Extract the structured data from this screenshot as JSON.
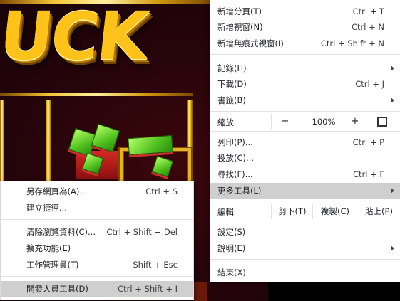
{
  "background": {
    "headline_text": "UCK"
  },
  "menu": {
    "new_tab": {
      "label": "新增分頁(T)",
      "shortcut": "Ctrl + T"
    },
    "new_window": {
      "label": "新增視窗(N)",
      "shortcut": "Ctrl + N"
    },
    "new_incognito": {
      "label": "新增無痕式視窗(I)",
      "shortcut": "Ctrl + Shift + N"
    },
    "history": {
      "label": "記錄(H)"
    },
    "downloads": {
      "label": "下載(D)",
      "shortcut": "Ctrl + J"
    },
    "bookmarks": {
      "label": "書籤(B)"
    },
    "zoom": {
      "label": "縮放",
      "minus": "−",
      "value": "100%",
      "plus": "+"
    },
    "print": {
      "label": "列印(P)...",
      "shortcut": "Ctrl + P"
    },
    "cast": {
      "label": "投放(C)..."
    },
    "find": {
      "label": "尋找(F)...",
      "shortcut": "Ctrl + F"
    },
    "more_tools": {
      "label": "更多工具(L)"
    },
    "edit": {
      "label": "編輯",
      "cut": "剪下(T)",
      "copy": "複製(C)",
      "paste": "貼上(P)"
    },
    "settings": {
      "label": "設定(S)"
    },
    "help": {
      "label": "說明(E)"
    },
    "exit": {
      "label": "結束(X)"
    }
  },
  "submenu": {
    "save_page": {
      "label": "另存網頁為(A)...",
      "shortcut": "Ctrl + S"
    },
    "create_shortcut": {
      "label": "建立捷徑..."
    },
    "clear_data": {
      "label": "清除瀏覽資料(C)...",
      "shortcut": "Ctrl + Shift + Del"
    },
    "extensions": {
      "label": "擴充功能(E)"
    },
    "task_manager": {
      "label": "工作管理員(T)",
      "shortcut": "Shift + Esc"
    },
    "dev_tools": {
      "label": "開發人員工具(D)",
      "shortcut": "Ctrl + Shift + I"
    }
  },
  "icons": {
    "submenu_arrow": "arrow-right-icon",
    "fullscreen": "fullscreen-icon"
  }
}
